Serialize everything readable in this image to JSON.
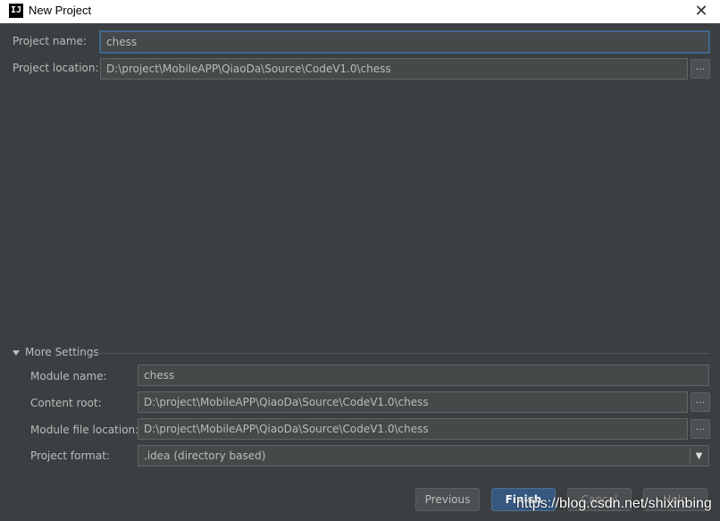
{
  "window": {
    "title": "New Project",
    "app_icon_text": "IJ",
    "close_glyph": "✕"
  },
  "project": {
    "name_label": "Project name:",
    "name_value": "chess",
    "location_label": "Project location:",
    "location_value": "D:\\project\\MobileAPP\\QiaoDa\\Source\\CodeV1.0\\chess"
  },
  "more_settings": {
    "toggle_label": "More Settings",
    "expanded": true,
    "module_name_label": "Module name:",
    "module_name_value": "chess",
    "content_root_label": "Content root:",
    "content_root_value": "D:\\project\\MobileAPP\\QiaoDa\\Source\\CodeV1.0\\chess",
    "module_file_label": "Module file location:",
    "module_file_value": "D:\\project\\MobileAPP\\QiaoDa\\Source\\CodeV1.0\\chess",
    "format_label": "Project format:",
    "format_value": ".idea (directory based)"
  },
  "browse_glyph": "...",
  "buttons": {
    "previous": "Previous",
    "finish": "Finish",
    "cancel": "Cancel",
    "help": "Help"
  },
  "watermark": "https://blog.csdn.net/shixinbing",
  "colors": {
    "background": "#3c3f41",
    "field_bg": "#45494a",
    "accent_focus": "#466d94",
    "primary_button": "#365880"
  },
  "icons": [
    "app-logo-icon",
    "close-icon",
    "browse-icon",
    "triangle-down-icon",
    "dropdown-arrow-icon"
  ]
}
